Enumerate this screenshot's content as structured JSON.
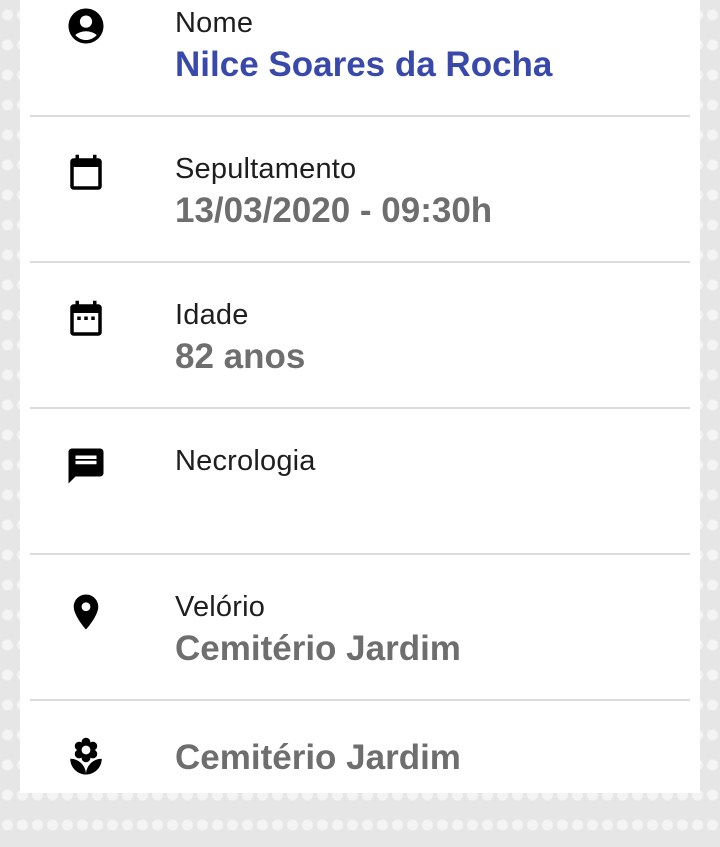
{
  "colors": {
    "name_accent": "#3949ab",
    "value_gray": "#6e6e6e",
    "label_text": "#1e1e1e",
    "divider": "#dcdcdc"
  },
  "fields": {
    "nome": {
      "icon": "account-circle-icon",
      "label": "Nome",
      "value": "Nilce Soares da Rocha"
    },
    "sepultamento": {
      "icon": "calendar-icon",
      "label": "Sepultamento",
      "value": "13/03/2020 - 09:30h"
    },
    "idade": {
      "icon": "calendar-dots-icon",
      "label": "Idade",
      "value": "82 anos"
    },
    "necrologia": {
      "icon": "message-icon",
      "label": "Necrologia",
      "value": ""
    },
    "velorio": {
      "icon": "location-pin-icon",
      "label": "Velório",
      "value": "Cemitério Jardim"
    },
    "local": {
      "icon": "flower-icon",
      "value": "Cemitério Jardim"
    }
  }
}
